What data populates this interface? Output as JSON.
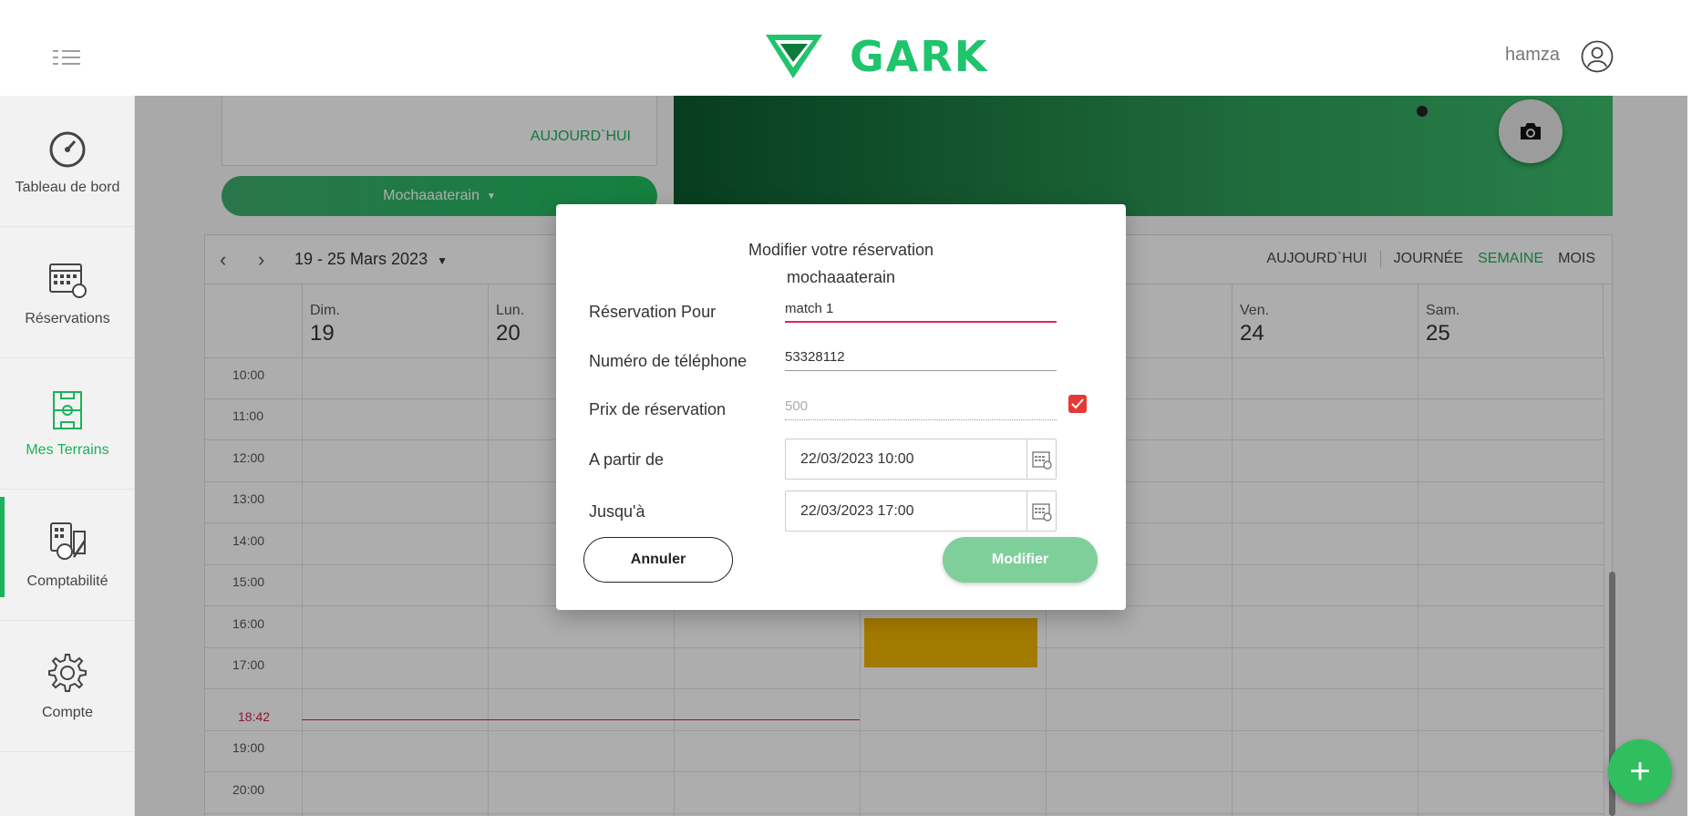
{
  "header": {
    "logo_text": "GARK",
    "user_name": "hamza"
  },
  "sidebar": {
    "items": [
      {
        "label": "Tableau de bord",
        "icon": "dashboard-gauge-icon"
      },
      {
        "label": "Réservations",
        "icon": "calendar-icon"
      },
      {
        "label": "Mes Terrains",
        "icon": "field-icon",
        "active": true
      },
      {
        "label": "Comptabilité",
        "icon": "accounting-icon"
      },
      {
        "label": "Compte",
        "icon": "gear-icon"
      }
    ]
  },
  "terrain": {
    "today_link": "AUJOURD`HUI",
    "selected": "Mochaaaterain"
  },
  "calendar": {
    "range": "19 - 25 Mars 2023",
    "views": [
      "AUJOURD`HUI",
      "JOURNÉE",
      "SEMAINE",
      "MOIS"
    ],
    "active_view": "SEMAINE",
    "days": [
      {
        "name": "Dim.",
        "num": "19"
      },
      {
        "name": "Lun.",
        "num": "20"
      },
      {
        "name": "",
        "num": ""
      },
      {
        "name": "",
        "num": ""
      },
      {
        "name": "",
        "num": ""
      },
      {
        "name": "Ven.",
        "num": "24"
      },
      {
        "name": "Sam.",
        "num": "25"
      }
    ],
    "times": [
      "10:00",
      "11:00",
      "12:00",
      "13:00",
      "14:00",
      "15:00",
      "16:00",
      "17:00",
      "19:00",
      "20:00"
    ],
    "now_label": "18:42",
    "accent_color": "#19b35b",
    "event_color": "#f0b400",
    "now_color": "#d0224a"
  },
  "modal": {
    "title_line1": "Modifier votre réservation",
    "title_line2": "mochaaaterain",
    "fields": {
      "reservation_label": "Réservation Pour",
      "reservation_value": "match 1",
      "phone_label": "Numéro de téléphone",
      "phone_value": "53328112",
      "price_label": "Prix de réservation",
      "price_value": "500",
      "from_label": "A partir de",
      "from_value": "22/03/2023 10:00",
      "to_label": "Jusqu'à",
      "to_value": "22/03/2023 17:00"
    },
    "price_checked": true,
    "cancel_label": "Annuler",
    "submit_label": "Modifier"
  },
  "fab_label": "+"
}
